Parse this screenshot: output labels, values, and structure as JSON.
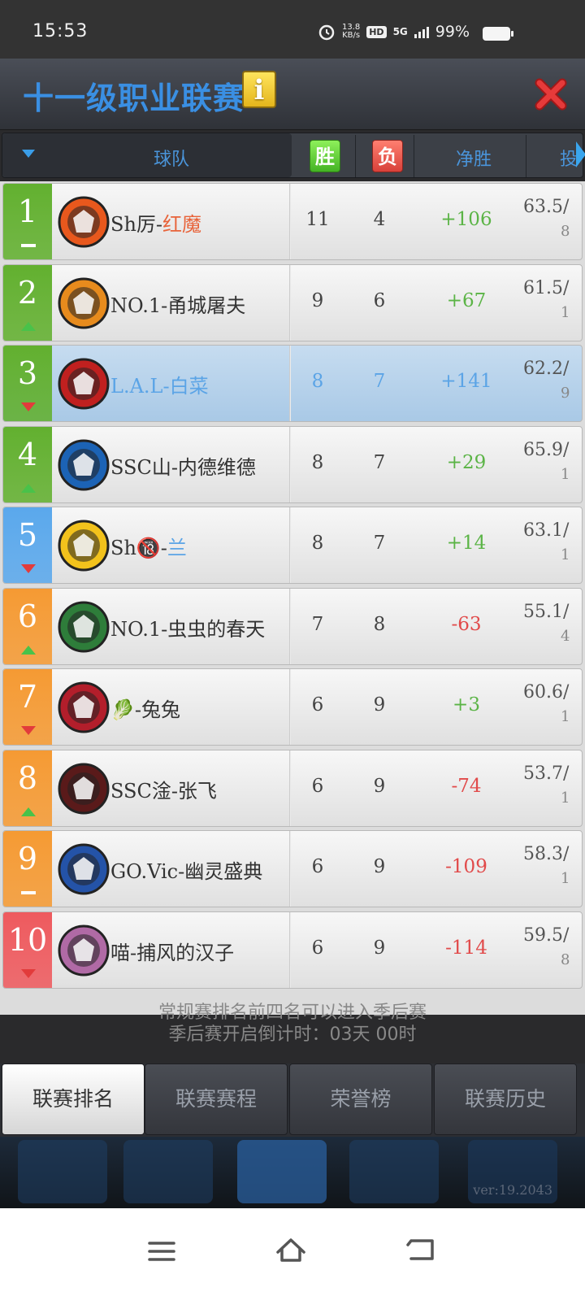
{
  "status_bar": {
    "time": "15:53",
    "net_speed_top": "13.8",
    "net_speed_unit": "KB/s",
    "hd": "HD",
    "signal": "5G",
    "battery": "99%"
  },
  "header": {
    "title": "十一级职业联赛",
    "info_label": "i"
  },
  "columns": {
    "team": "球队",
    "wins": "胜",
    "losses": "负",
    "net": "净胜",
    "more": "投"
  },
  "rows": [
    {
      "rank": "1",
      "trend": "flat",
      "rank_color": "#62b02f",
      "name_prefix": "Sh厉-",
      "name_suffix": "红魔",
      "suffix_style": "hl",
      "wins": "11",
      "losses": "4",
      "net": "+106",
      "net_sign": "pos",
      "extra": "63.5/",
      "extra2": "8"
    },
    {
      "rank": "2",
      "trend": "up",
      "rank_color": "#62b02f",
      "name_prefix": "NO.1-甬城屠夫",
      "name_suffix": "",
      "suffix_style": "",
      "wins": "9",
      "losses": "6",
      "net": "+67",
      "net_sign": "pos",
      "extra": "61.5/",
      "extra2": "1"
    },
    {
      "rank": "3",
      "trend": "down",
      "rank_color": "#62b02f",
      "name_prefix": "L.A.L-白菜",
      "name_suffix": "",
      "suffix_style": "",
      "wins": "8",
      "losses": "7",
      "net": "+141",
      "net_sign": "pos",
      "extra": "62.2/",
      "extra2": "9",
      "highlight": true
    },
    {
      "rank": "4",
      "trend": "up",
      "rank_color": "#62b02f",
      "name_prefix": "SSC山-内德维德",
      "name_suffix": "",
      "suffix_style": "",
      "wins": "8",
      "losses": "7",
      "net": "+29",
      "net_sign": "pos",
      "extra": "65.9/",
      "extra2": "1"
    },
    {
      "rank": "5",
      "trend": "down",
      "rank_color": "#5aa8ec",
      "name_prefix": "Sh🔞-",
      "name_suffix": "兰",
      "suffix_style": "blue",
      "wins": "8",
      "losses": "7",
      "net": "+14",
      "net_sign": "pos",
      "extra": "63.1/",
      "extra2": "1"
    },
    {
      "rank": "6",
      "trend": "up",
      "rank_color": "#f59a33",
      "name_prefix": "NO.1-虫虫的春天",
      "name_suffix": "",
      "suffix_style": "",
      "wins": "7",
      "losses": "8",
      "net": "-63",
      "net_sign": "neg",
      "extra": "55.1/",
      "extra2": "4"
    },
    {
      "rank": "7",
      "trend": "down",
      "rank_color": "#f59a33",
      "name_prefix": "🥬-兔兔",
      "name_suffix": "",
      "suffix_style": "",
      "wins": "6",
      "losses": "9",
      "net": "+3",
      "net_sign": "pos",
      "extra": "60.6/",
      "extra2": "1"
    },
    {
      "rank": "8",
      "trend": "up",
      "rank_color": "#f59a33",
      "name_prefix": "SSC淦-张飞",
      "name_suffix": "",
      "suffix_style": "",
      "wins": "6",
      "losses": "9",
      "net": "-74",
      "net_sign": "neg",
      "extra": "53.7/",
      "extra2": "1"
    },
    {
      "rank": "9",
      "trend": "flat",
      "rank_color": "#f59a33",
      "name_prefix": "GO.Vic-幽灵盛典",
      "name_suffix": "",
      "suffix_style": "",
      "wins": "6",
      "losses": "9",
      "net": "-109",
      "net_sign": "neg",
      "extra": "58.3/",
      "extra2": "1"
    },
    {
      "rank": "10",
      "trend": "down",
      "rank_color": "#ee5a5e",
      "name_prefix": "喵-捕风的汉子",
      "name_suffix": "",
      "suffix_style": "",
      "wins": "6",
      "losses": "9",
      "net": "-114",
      "net_sign": "neg",
      "extra": "59.5/",
      "extra2": "8"
    }
  ],
  "notice": {
    "line1": "常规赛排名前四名可以进入季后赛",
    "line2": "季后赛开启倒计时：03天 00时"
  },
  "tabs": [
    "联赛排名",
    "联赛赛程",
    "荣誉榜",
    "联赛历史"
  ],
  "version": "ver:19.2043",
  "colors": {
    "title_blue": "#3a8fe3",
    "positive": "#5bb446",
    "negative": "#e14a4a",
    "highlight_row": "#b6d2ec"
  }
}
